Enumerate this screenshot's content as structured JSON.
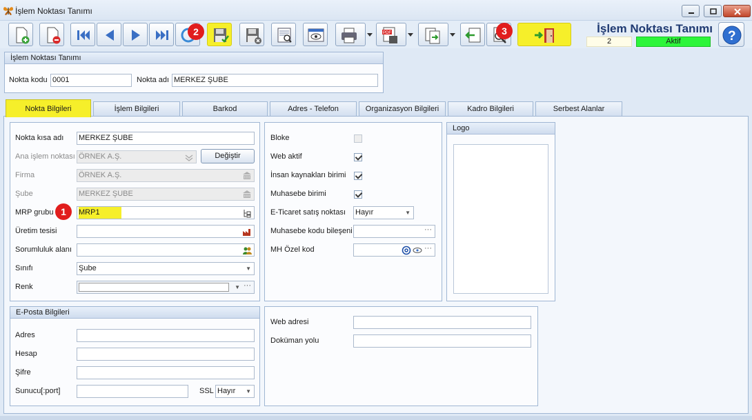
{
  "window": {
    "title": "İşlem Noktası Tanımı"
  },
  "header": {
    "form_title": "İşlem Noktası Tanımı",
    "record_count": "2",
    "status": "Aktif"
  },
  "badges": [
    "1",
    "2",
    "3"
  ],
  "toolbar": {
    "buttons": [
      "new-record-icon",
      "delete-record-icon",
      "first-record-icon",
      "previous-record-icon",
      "next-record-icon",
      "last-record-icon",
      "refresh-icon",
      "save-icon",
      "save-close-icon",
      "preview-icon",
      "view-icon",
      "print-icon",
      "pdf-export-icon",
      "export-icon",
      "import-icon",
      "search-icon",
      "exit-icon",
      "help-icon"
    ]
  },
  "point_group": {
    "title": "İşlem Noktası Tanımı",
    "code_label": "Nokta kodu",
    "code_value": "0001",
    "name_label": "Nokta adı",
    "name_value": "MERKEZ ŞUBE"
  },
  "tabs": [
    {
      "label": "Nokta Bilgileri",
      "active": true
    },
    {
      "label": "İşlem Bilgileri"
    },
    {
      "label": "Barkod"
    },
    {
      "label": "Adres - Telefon"
    },
    {
      "label": "Organizasyon Bilgileri"
    },
    {
      "label": "Kadro Bilgileri"
    },
    {
      "label": "Serbest Alanlar"
    }
  ],
  "details": {
    "short_name_label": "Nokta kısa adı",
    "short_name_value": "MERKEZ ŞUBE",
    "main_point_label": "Ana işlem noktası",
    "main_point_value": "ÖRNEK A.Ş.",
    "change_button": "Değiştir",
    "company_label": "Firma",
    "company_value": "ÖRNEK A.Ş.",
    "branch_label": "Şube",
    "branch_value": "MERKEZ ŞUBE",
    "mrp_label": "MRP grubu",
    "mrp_value": "MRP1",
    "production_label": "Üretim tesisi",
    "production_value": "",
    "responsibility_label": "Sorumluluk alanı",
    "responsibility_value": "",
    "class_label": "Sınıfı",
    "class_value": "Şube",
    "color_label": "Renk",
    "color_value": ""
  },
  "flags": {
    "blocked_label": "Bloke",
    "blocked": false,
    "web_active_label": "Web aktif",
    "web_active": true,
    "hr_unit_label": "İnsan kaynakları birimi",
    "hr_unit": true,
    "accounting_unit_label": "Muhasebe birimi",
    "accounting_unit": true,
    "ecommerce_label": "E-Ticaret satış noktası",
    "ecommerce_value": "Hayır",
    "accounting_code_label": "Muhasebe kodu bileşeni",
    "accounting_code_value": "",
    "mh_code_label": "MH Özel kod",
    "mh_code_value": ""
  },
  "logo": {
    "title": "Logo"
  },
  "email": {
    "title": "E-Posta Bilgileri",
    "address_label": "Adres",
    "address_value": "",
    "account_label": "Hesap",
    "account_value": "",
    "password_label": "Şifre",
    "password_value": "",
    "server_label": "Sunucu[:port]",
    "server_value": "",
    "ssl_label": "SSL",
    "ssl_value": "Hayır"
  },
  "web": {
    "web_address_label": "Web adresi",
    "web_address_value": "",
    "document_path_label": "Doküman yolu",
    "document_path_value": ""
  },
  "colors": {
    "highlight": "#f6ef2a",
    "status_active": "#2df53a",
    "badge": "#e11d1d",
    "title_blue": "#1f3a72"
  }
}
